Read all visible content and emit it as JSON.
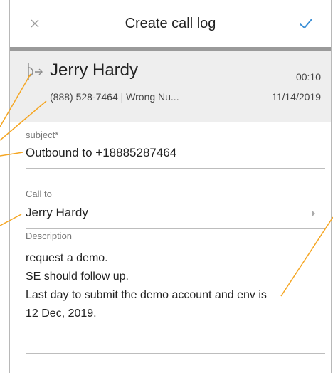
{
  "header": {
    "title": "Create call log",
    "close_icon": "close-icon",
    "confirm_icon": "check-icon"
  },
  "call": {
    "direction_icon": "outbound-call-icon",
    "name": "Jerry Hardy",
    "duration": "00:10",
    "number_result": "(888) 528-7464 | Wrong Nu...",
    "date": "11/14/2019"
  },
  "form": {
    "subject_label": "subject*",
    "subject_value": "Outbound to +18885287464",
    "call_to_label": "Call to",
    "call_to_value": "Jerry Hardy",
    "description_label": "Description",
    "description_lines": [
      "request a demo.",
      "SE should follow up.",
      "Last day to submit the demo account and env is",
      "12 Dec, 2019."
    ]
  },
  "colors": {
    "accent": "#3b8fd6",
    "annotation": "#f5a623",
    "summary_bg": "#eeeeee"
  }
}
